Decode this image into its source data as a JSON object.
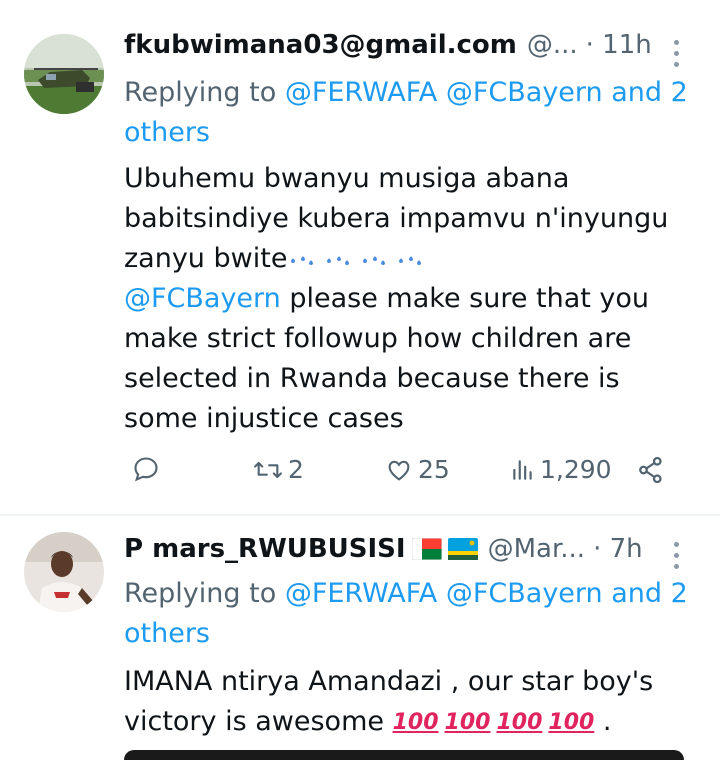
{
  "tweets": [
    {
      "display_name": "fkubwimana03@gmail.com",
      "handle": "@...",
      "time": "· 11h",
      "replying_prefix": "Replying to ",
      "replying_mentions": "@FERWAFA @FCBayern and 2 others",
      "text_line1": "Ubuhemu bwanyu musiga abana babitsindiye kubera impamvu n'inyungu zanyu bwite",
      "mention": "@FCBayern",
      "text_line2": " please make sure that you make strict followup how children are selected in Rwanda because there is some injustice cases",
      "reply_count": "",
      "retweet_count": "2",
      "like_count": "25",
      "view_count": "1,290"
    },
    {
      "display_name": "P mars_RWUBUSISI",
      "handle": "@Mar...",
      "time": "· 7h",
      "replying_prefix": "Replying to ",
      "replying_mentions": "@FERWAFA @FCBayern and 2 others",
      "text": "IMANA ntirya Amandazi , our star boy's victory is awesome",
      "text_end": " .",
      "hundred_symbols": [
        "100",
        "100",
        "100",
        "100"
      ]
    }
  ],
  "icons": [
    "helicopter-avatar",
    "profile-photo-avatar",
    "madagascar-flag-icon",
    "rwanda-flag-icon",
    "sweat-drops-emoji",
    "hundred-points-emoji",
    "more-options-icon",
    "reply-icon",
    "retweet-icon",
    "like-icon",
    "views-icon",
    "share-icon"
  ],
  "colors": {
    "link": "#1d9bf0",
    "secondary_text": "#536471",
    "primary_text": "#0f1419"
  }
}
